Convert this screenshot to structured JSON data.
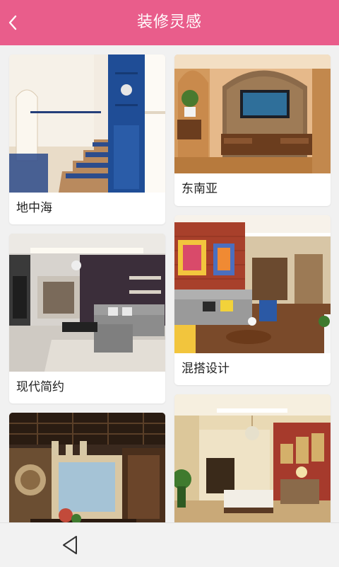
{
  "header": {
    "title": "装修灵感",
    "back_icon": "chevron-left-icon"
  },
  "cards": [
    {
      "label": "地中海"
    },
    {
      "label": "东南亚"
    },
    {
      "label": "现代简约"
    },
    {
      "label": "混搭设计"
    },
    {
      "label": ""
    },
    {
      "label": ""
    }
  ],
  "navbar": {
    "back_icon": "triangle-back-icon"
  },
  "colors": {
    "accent": "#e95d8b",
    "background": "#f1f1f1",
    "card": "#ffffff"
  }
}
